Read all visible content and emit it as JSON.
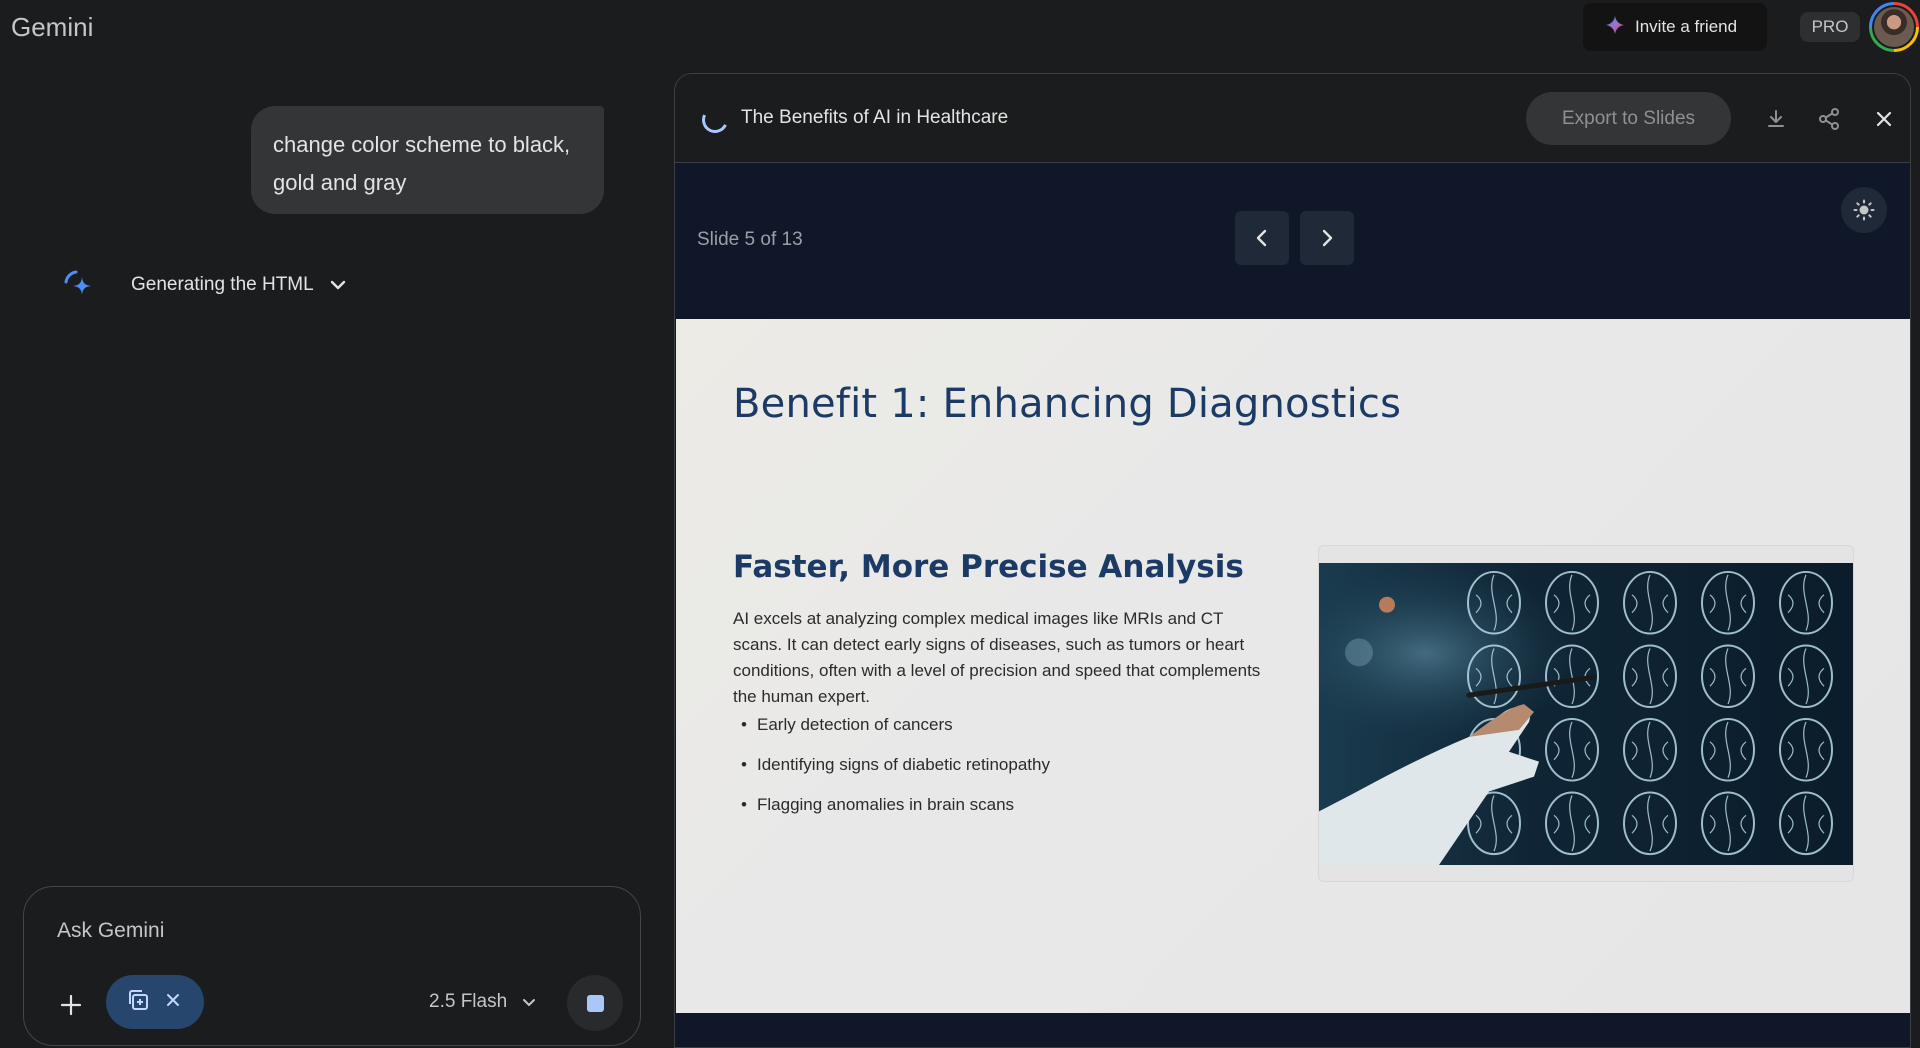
{
  "app": {
    "name": "Gemini"
  },
  "topbar": {
    "invite_label": "Invite a friend",
    "pro_label": "PRO"
  },
  "chat": {
    "user_message": "change color scheme to black, gold and gray",
    "status_label": "Generating the HTML"
  },
  "composer": {
    "placeholder": "Ask Gemini",
    "model_label": "2.5 Flash"
  },
  "canvas": {
    "title": "The Benefits of AI in Healthcare",
    "export_label": "Export to Slides",
    "slide_counter": "Slide 5 of 13",
    "slide": {
      "title": "Benefit 1: Enhancing Diagnostics",
      "subtitle": "Faster, More Precise Analysis",
      "paragraph": "AI excels at analyzing complex medical images like MRIs and CT scans. It can detect early signs of diseases, such as tumors or heart conditions, often with a level of precision and speed that complements the human expert.",
      "bullets": [
        "Early detection of cancers",
        "Identifying signs of diabetic retinopathy",
        "Flagging anomalies in brain scans"
      ]
    }
  },
  "icons": {
    "invite": "sparkle-icon",
    "status": "gemini-sparkle-icon",
    "download": "download-icon",
    "share": "share-icon",
    "close": "close-icon",
    "theme": "brightness-icon"
  },
  "colors": {
    "background": "#1b1c1d",
    "slide_title": "#1b3a66",
    "viewer_bg": "#0f1729",
    "accent_blue": "#a8c7fa"
  }
}
